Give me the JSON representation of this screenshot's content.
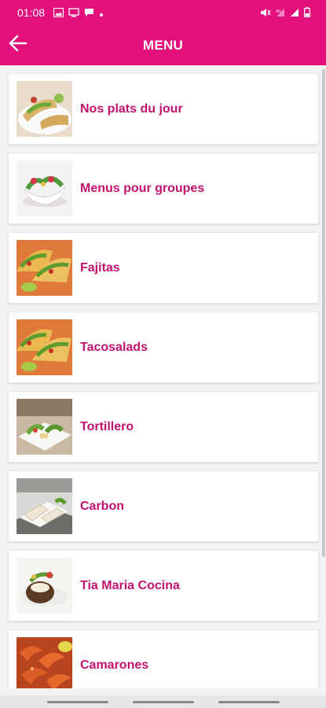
{
  "status_bar": {
    "time": "01:08",
    "left_icons": [
      "image-icon",
      "cast-icon",
      "chat-icon",
      "dot-icon"
    ],
    "right_icons": [
      "mute-icon",
      "signal-icon",
      "wifi-signal-icon",
      "battery-icon"
    ]
  },
  "app_bar": {
    "title": "MENU",
    "back_icon": "arrow-left-icon"
  },
  "menu": {
    "items": [
      {
        "label": "Nos plats du jour",
        "image": "wrap-plate"
      },
      {
        "label": "Menus pour groupes",
        "image": "shell-salad"
      },
      {
        "label": "Fajitas",
        "image": "tacos"
      },
      {
        "label": "Tacosalads",
        "image": "tacos"
      },
      {
        "label": "Tortillero",
        "image": "tortilla-plate"
      },
      {
        "label": "Carbon",
        "image": "burrito-plate"
      },
      {
        "label": "Tia Maria Cocina",
        "image": "potato-plate"
      },
      {
        "label": "Camarones",
        "image": "shrimp"
      }
    ]
  },
  "colors": {
    "brand": "#e20f7c",
    "label": "#c2126f",
    "background": "#f3f3f3"
  }
}
